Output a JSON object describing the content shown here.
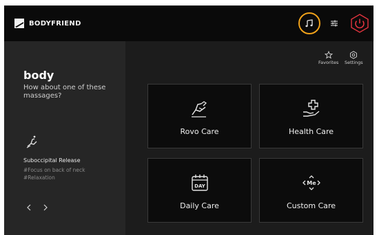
{
  "header": {
    "brand": "BODYFRIEND",
    "music_icon": "music-note-icon",
    "tune_icon": "sliders-icon",
    "power_icon": "power-icon",
    "accent_color": "#f0a21a",
    "power_color": "#e5343f"
  },
  "left_panel": {
    "title": "body",
    "subtitle": "How about one of these massages?",
    "featured": {
      "icon": "recline-chair-icon",
      "name": "Suboccipital Release",
      "tags": [
        "#Focus on back of neck",
        "#Relaxation"
      ]
    },
    "prev_icon": "chevron-left-icon",
    "next_icon": "chevron-right-icon"
  },
  "toolbar": {
    "favorites_label": "Favorites",
    "settings_label": "Settings"
  },
  "cards": [
    {
      "label": "Rovo Care",
      "icon": "massage-chair-icon"
    },
    {
      "label": "Health Care",
      "icon": "hand-plus-icon"
    },
    {
      "label": "Daily Care",
      "icon": "calendar-day-icon",
      "icon_text": "DAY"
    },
    {
      "label": "Custom Care",
      "icon": "me-arrows-icon",
      "icon_text": "Me"
    }
  ]
}
